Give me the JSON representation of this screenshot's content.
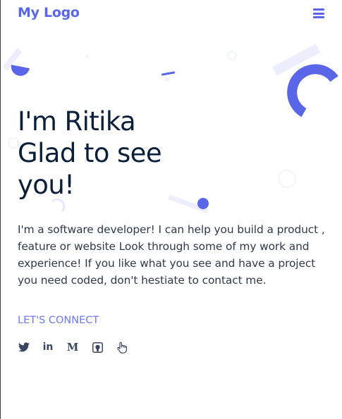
{
  "nav": {
    "logo": "My Logo",
    "menu_icon": "hamburger-menu-icon"
  },
  "hero": {
    "headline_line1": "I'm Ritika",
    "headline_line2": "Glad to see",
    "headline_line3": "you!",
    "intro": "I'm a software developer! I can help you build a product , feature or website Look through some of my work and experience! If you like what you see and have a project you need coded, don't hestiate to contact me.",
    "cta": "LET'S CONNECT"
  },
  "socials": [
    {
      "icon": "twitter-icon"
    },
    {
      "icon": "linkedin-icon",
      "glyph": "in"
    },
    {
      "icon": "medium-icon",
      "glyph": "M"
    },
    {
      "icon": "github-icon"
    },
    {
      "icon": "hand-pointer-icon"
    }
  ],
  "colors": {
    "brand": "#5a66e8",
    "heading": "#0b1f3a",
    "body_text": "#2e3a4a",
    "link": "#6f78ec",
    "decor_light": "#eceefd"
  }
}
